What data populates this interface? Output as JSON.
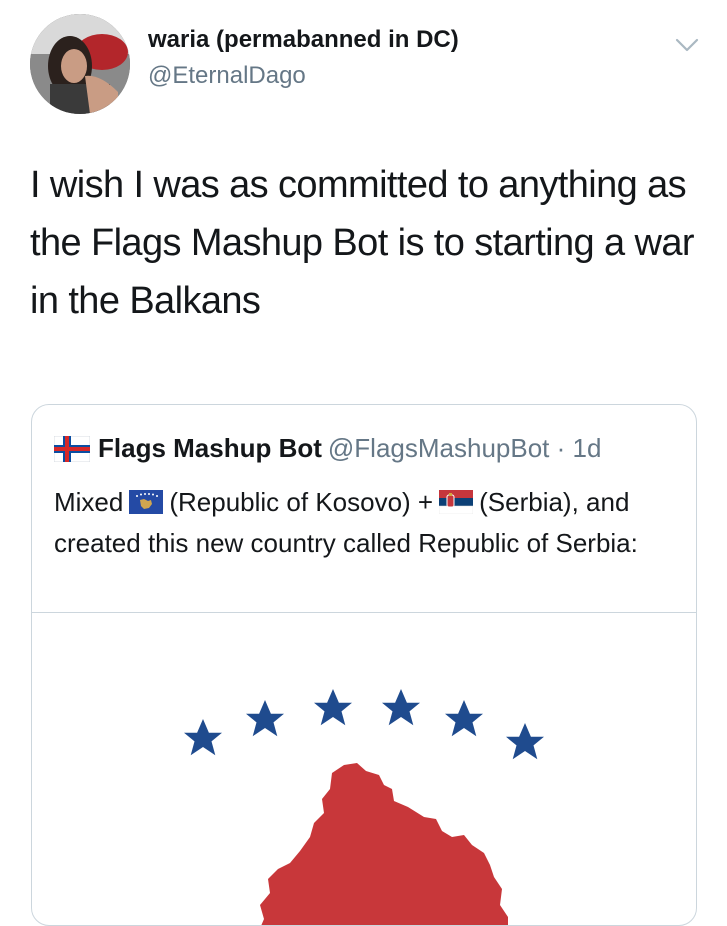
{
  "tweet": {
    "author": {
      "display_name": "waria (permabanned in DC)",
      "handle": "@EternalDago",
      "avatar_icon": "user-avatar-photo"
    },
    "menu_icon": "chevron-down-icon",
    "text": "I wish I was as committed to anything as the Flags Mashup Bot is to starting a war in the Balkans"
  },
  "quoted_tweet": {
    "flag_icon": "faroe-islands-flag-icon",
    "display_name": "Flags Mashup Bot",
    "handle_time": "@FlagsMashupBot · 1d",
    "body": {
      "part1": "Mixed",
      "flag1_icon": "kosovo-flag-icon",
      "part2": "(Republic of Kosovo) +",
      "flag2_icon": "serbia-flag-icon",
      "part3": "(Serbia), and created this new country called Republic of Serbia:"
    },
    "media": {
      "description_icon": "mashup-flag-image",
      "star_count": 6,
      "colors": {
        "stars": "#1f4b8e",
        "map": "#c8373a",
        "background": "#ffffff"
      }
    }
  },
  "colors": {
    "text": "#14171a",
    "secondary": "#657786",
    "border": "#ccd6dd"
  }
}
